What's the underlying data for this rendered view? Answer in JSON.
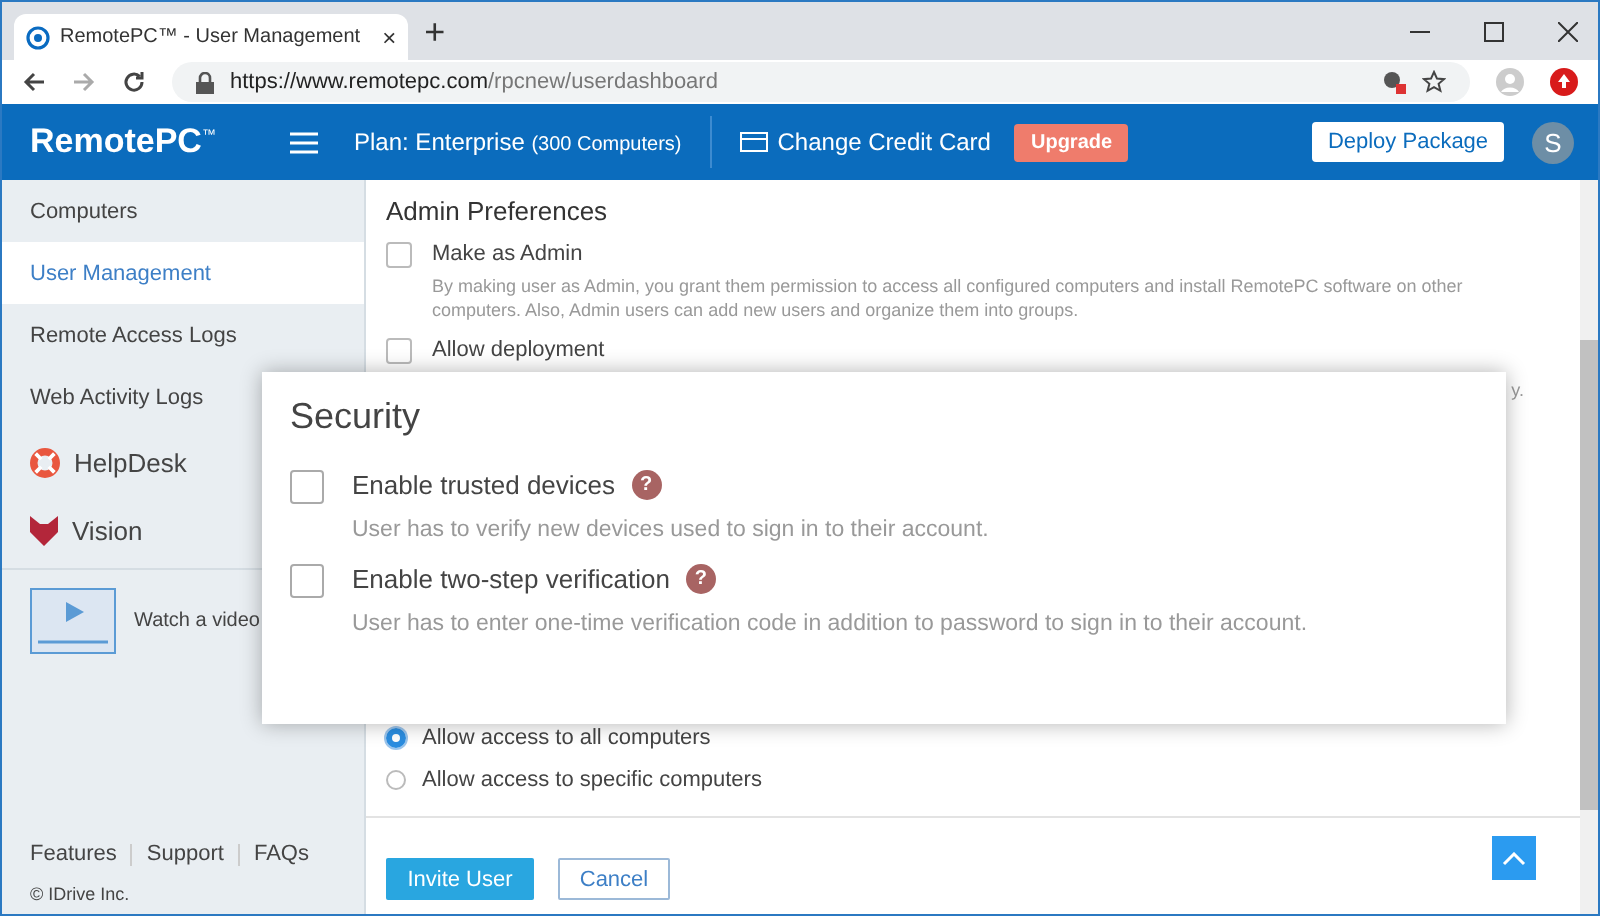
{
  "browser": {
    "tab_title": "RemotePC™ - User Management",
    "tab_close": "×",
    "new_tab": "+",
    "url_host": "https://www.remotepc.com",
    "url_path": "/rpcnew/userdashboard"
  },
  "header": {
    "logo": "RemotePC",
    "logo_mark": "™",
    "plan_label": "Plan: Enterprise",
    "plan_detail": "(300 Computers)",
    "change_card": "Change Credit Card",
    "upgrade": "Upgrade",
    "deploy": "Deploy Package",
    "avatar": "S"
  },
  "sidebar": {
    "items": [
      {
        "label": "Computers",
        "kind": "plain",
        "selected": false
      },
      {
        "label": "User Management",
        "kind": "plain",
        "selected": true
      },
      {
        "label": "Remote Access Logs",
        "kind": "plain",
        "selected": false
      },
      {
        "label": "Web Activity Logs",
        "kind": "plain",
        "selected": false
      },
      {
        "label": "HelpDesk",
        "kind": "helpdesk",
        "selected": false
      },
      {
        "label": "Vision",
        "kind": "vision",
        "selected": false
      }
    ],
    "video": "Watch a video",
    "footer_links": [
      "Features",
      "Support",
      "FAQs"
    ],
    "copyright": "© IDrive Inc."
  },
  "admin_preferences": {
    "title": "Admin Preferences",
    "options": [
      {
        "label": "Make as Admin",
        "checked": false,
        "description": "By making user as Admin, you grant them permission to access all configured computers and install RemotePC software on other computers. Also, Admin users can add new users and organize them into groups."
      },
      {
        "label": "Allow deployment",
        "checked": false
      }
    ],
    "deploy_note_tail": "y."
  },
  "access": {
    "radios": [
      {
        "label": "Allow access to all computers",
        "selected": true
      },
      {
        "label": "Allow access to specific computers",
        "selected": false
      }
    ]
  },
  "actions": {
    "invite": "Invite User",
    "cancel": "Cancel"
  },
  "security_dialog": {
    "title": "Security",
    "options": [
      {
        "label": "Enable trusted devices",
        "checked": false,
        "help": "?",
        "description": "User has to verify new devices used to sign in to their account."
      },
      {
        "label": "Enable two-step verification",
        "checked": false,
        "help": "?",
        "description": "User has to enter one-time verification code in addition to password to sign in to their account."
      }
    ]
  }
}
